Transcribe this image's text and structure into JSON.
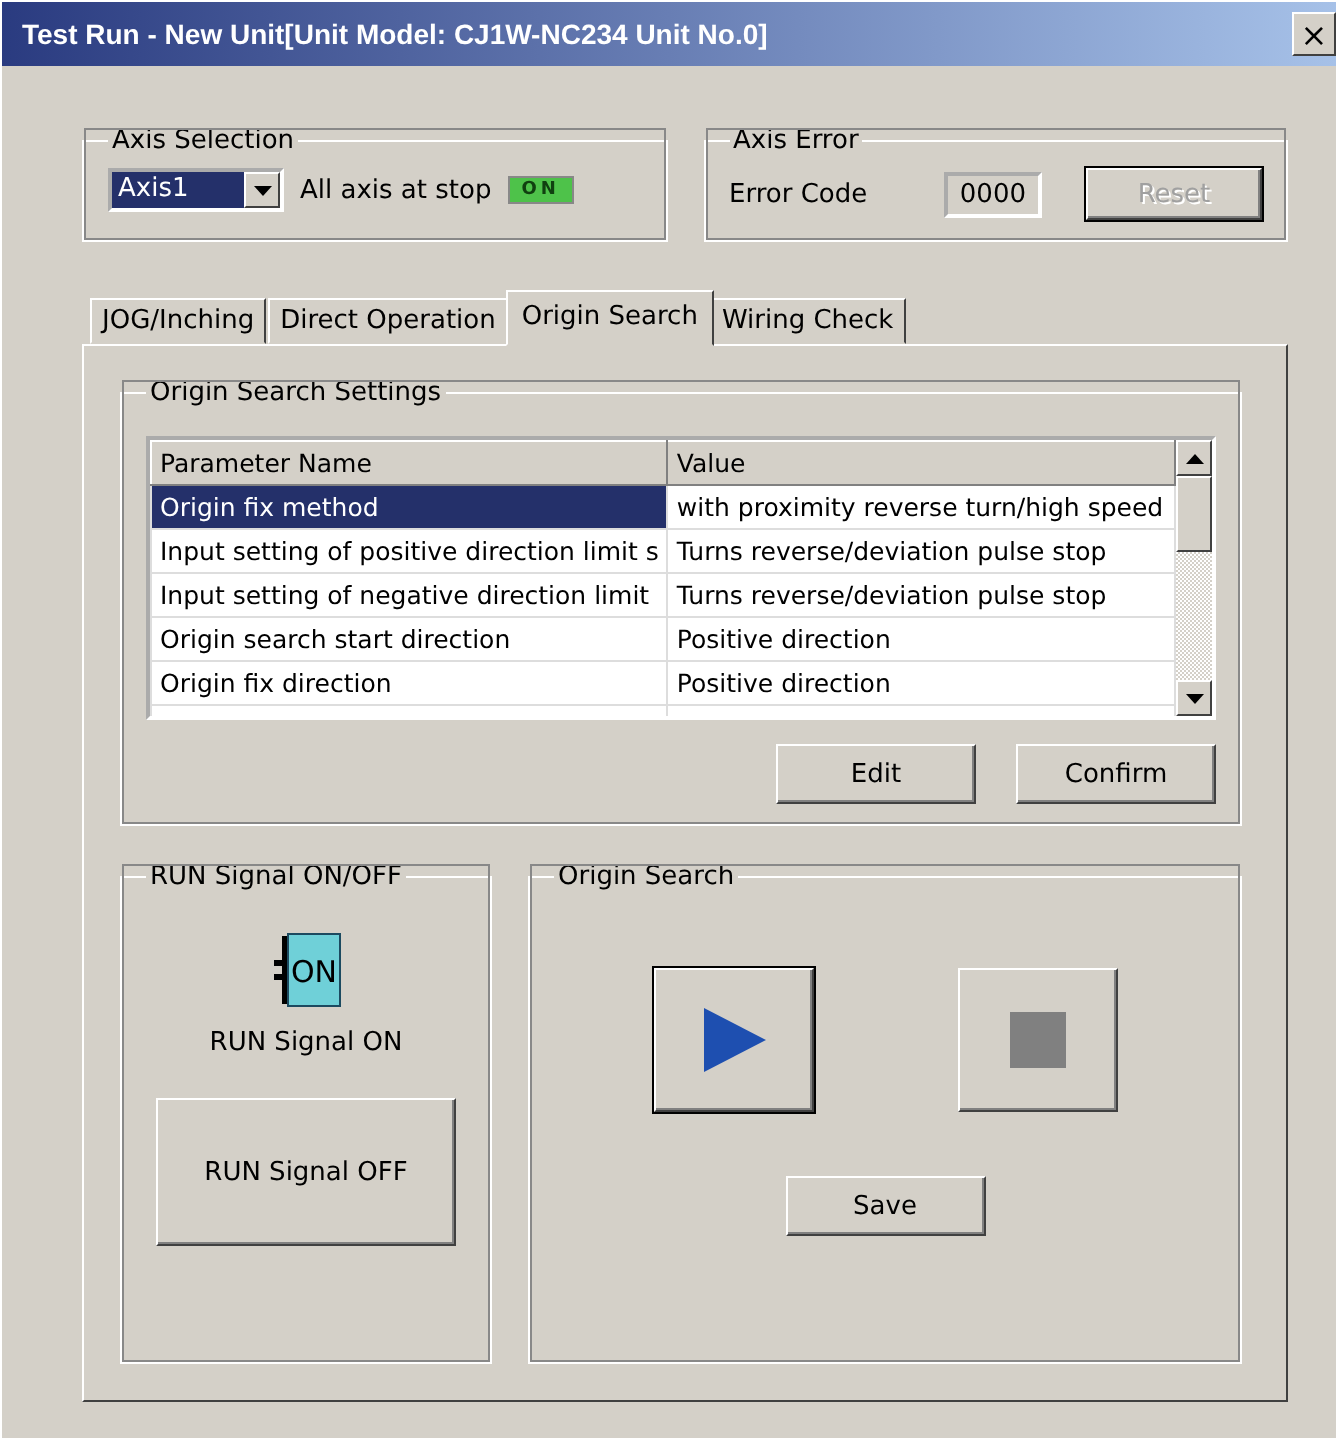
{
  "window": {
    "title": "Test Run - New Unit[Unit Model: CJ1W-NC234 Unit No.0]",
    "close": "×"
  },
  "axis_selection": {
    "title": "Axis Selection",
    "value": "Axis1",
    "status_label": "All axis at stop",
    "indicator": "ON",
    "indicator_on": true
  },
  "axis_error": {
    "title": "Axis Error",
    "label": "Error Code",
    "value": "0000",
    "reset": {
      "label": "Reset",
      "disabled": true
    }
  },
  "tabs": [
    {
      "label": "JOG/Inching",
      "selected": false
    },
    {
      "label": "Direct Operation",
      "selected": false
    },
    {
      "label": "Origin Search",
      "selected": true
    },
    {
      "label": "Wiring Check",
      "selected": false
    }
  ],
  "settings": {
    "title": "Origin Search Settings",
    "columns": [
      "Parameter Name",
      "Value"
    ],
    "rows": [
      {
        "name": "Origin fix method",
        "value": "with proximity reverse turn/high speed",
        "selected": true
      },
      {
        "name": "Input setting of positive direction limit s",
        "value": "Turns reverse/deviation pulse stop",
        "selected": false
      },
      {
        "name": "Input setting of negative direction limit",
        "value": "Turns reverse/deviation pulse stop",
        "selected": false
      },
      {
        "name": "Origin search start direction",
        "value": "Positive direction",
        "selected": false
      },
      {
        "name": "Origin fix direction",
        "value": "Positive direction",
        "selected": false
      }
    ],
    "buttons": [
      "Edit",
      "Confirm"
    ]
  },
  "run_signal": {
    "title": "RUN Signal ON/OFF",
    "icon_text": "ON",
    "status": "RUN Signal ON",
    "button": "RUN Signal OFF"
  },
  "origin_search": {
    "title": "Origin Search",
    "save": "Save"
  }
}
